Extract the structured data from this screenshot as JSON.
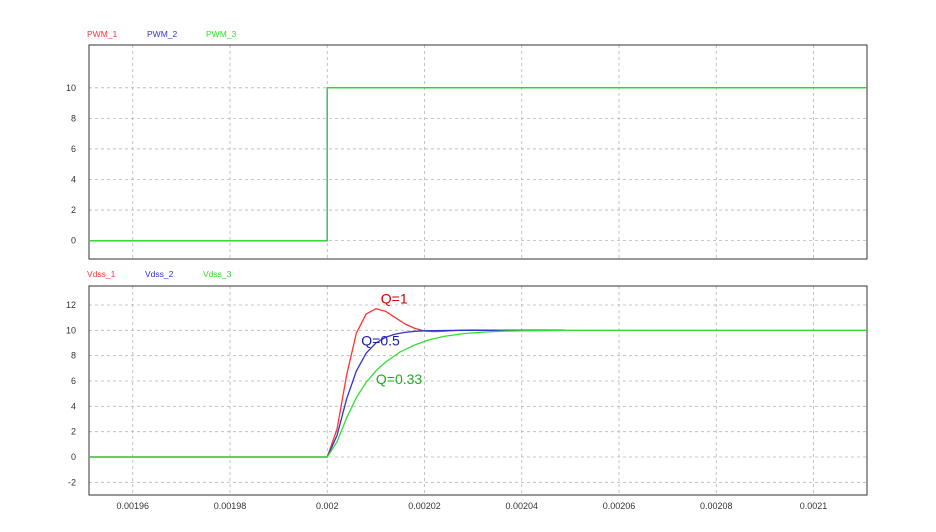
{
  "chart_data": [
    {
      "type": "line",
      "legend_position": "top-left",
      "grid": true,
      "xlim": [
        0.001951,
        0.002111
      ],
      "ylim": [
        -1.2,
        12.8
      ],
      "yticks": [
        0,
        2,
        4,
        6,
        8,
        10
      ],
      "ytick_labels": [
        "0",
        "2",
        "4",
        "6",
        "8",
        "10"
      ],
      "series": [
        {
          "name": "PWM_1",
          "color": "#ff3333",
          "x": [
            0.001951,
            0.002,
            0.002,
            0.002111
          ],
          "values": [
            0,
            0,
            10,
            10
          ]
        },
        {
          "name": "PWM_2",
          "color": "#3333cc",
          "x": [
            0.001951,
            0.002,
            0.002,
            0.002111
          ],
          "values": [
            0,
            0,
            10,
            10
          ]
        },
        {
          "name": "PWM_3",
          "color": "#33dd33",
          "x": [
            0.001951,
            0.002,
            0.002,
            0.002111
          ],
          "values": [
            0,
            0,
            10,
            10
          ]
        }
      ]
    },
    {
      "type": "line",
      "legend_position": "top-left",
      "grid": true,
      "xlim": [
        0.001951,
        0.002111
      ],
      "ylim": [
        -3,
        13.5
      ],
      "xticks": [
        0.00196,
        0.00198,
        0.002,
        0.00202,
        0.00204,
        0.00206,
        0.00208,
        0.0021
      ],
      "xtick_labels": [
        "0.00196",
        "0.00198",
        "0.002",
        "0.00202",
        "0.00204",
        "0.00206",
        "0.00208",
        "0.0021"
      ],
      "yticks": [
        -2,
        0,
        2,
        4,
        6,
        8,
        10,
        12
      ],
      "ytick_labels": [
        "-2",
        "0",
        "2",
        "4",
        "6",
        "8",
        "10",
        "12"
      ],
      "series": [
        {
          "name": "Vdss_1",
          "color": "#ff3333",
          "x": [
            0.001951,
            0.002,
            0.002002,
            0.002004,
            0.002006,
            0.002008,
            0.00201,
            0.002012,
            0.002014,
            0.002016,
            0.002018,
            0.00202,
            0.002022,
            0.002024,
            0.002026,
            0.002028,
            0.00203,
            0.002035,
            0.00204,
            0.002045,
            0.002049
          ],
          "values": [
            0,
            0,
            2.2,
            6.5,
            9.8,
            11.3,
            11.7,
            11.5,
            11.0,
            10.5,
            10.15,
            9.95,
            9.9,
            9.93,
            9.98,
            10.02,
            10.03,
            10.0,
            10.0,
            10.0,
            10.0
          ]
        },
        {
          "name": "Vdss_2",
          "color": "#3333cc",
          "x": [
            0.001951,
            0.002,
            0.002002,
            0.002004,
            0.002006,
            0.002008,
            0.00201,
            0.002012,
            0.002014,
            0.002016,
            0.002018,
            0.00202,
            0.002024,
            0.002028,
            0.002032,
            0.002036,
            0.00204,
            0.002045,
            0.002049
          ],
          "values": [
            0,
            0,
            1.7,
            4.6,
            6.8,
            8.2,
            9.0,
            9.45,
            9.7,
            9.84,
            9.92,
            9.96,
            9.99,
            10.0,
            10.0,
            10.0,
            10.0,
            10.0,
            10.0
          ]
        },
        {
          "name": "Vdss_3",
          "color": "#33dd33",
          "x": [
            0.001951,
            0.002,
            0.002002,
            0.002004,
            0.002006,
            0.002008,
            0.00201,
            0.002012,
            0.002015,
            0.002018,
            0.002021,
            0.002024,
            0.002028,
            0.002032,
            0.002036,
            0.00204,
            0.002045,
            0.00205,
            0.002111
          ],
          "values": [
            0,
            0,
            1.2,
            3.1,
            4.7,
            5.9,
            6.8,
            7.5,
            8.3,
            8.85,
            9.25,
            9.52,
            9.74,
            9.86,
            9.93,
            9.96,
            9.98,
            10.0,
            10.0
          ]
        }
      ],
      "annotations": [
        {
          "text": "Q=1",
          "x": 0.002011,
          "y": 12.1,
          "color": "#cc0000"
        },
        {
          "text": "Q=0.5",
          "x": 0.002007,
          "y": 8.8,
          "color": "#1a1aaa"
        },
        {
          "text": "Q=0.33",
          "x": 0.00201,
          "y": 5.75,
          "color": "#22aa22"
        }
      ]
    }
  ]
}
